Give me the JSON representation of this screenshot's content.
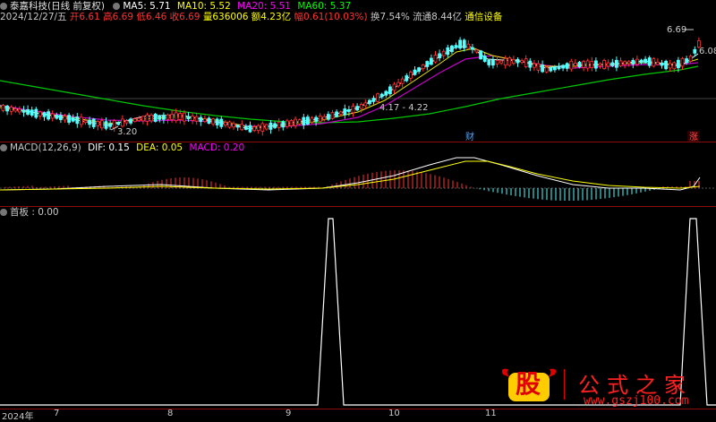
{
  "main_header": {
    "stock_name": "泰嘉科技(日线 前复权)",
    "ma5": "MA5: 5.71",
    "ma10": "MA10: 5.52",
    "ma20": "MA20: 5.51",
    "ma60": "MA60: 5.37"
  },
  "quote_line": {
    "date": "2024/12/27/五",
    "open": "开6.61",
    "high": "高6.69",
    "low": "低6.46",
    "close": "收6.69",
    "volume": "量636006",
    "amount": "额4.23亿",
    "change_pct": "幅0.61(10.03%)",
    "turnover": "换7.54%",
    "float_cap": "流通8.44亿",
    "sector": "通信设备"
  },
  "price_labels": {
    "high_mark": "6.69",
    "right_price": "6.08",
    "range_label": "4.17 - 4.22",
    "low_mark": "3.20"
  },
  "event_badges": {
    "cai": "财",
    "zhang": "涨"
  },
  "macd_header": {
    "name": "MACD(12,26,9)",
    "dif": "DIF: 0.15",
    "dea": "DEA: 0.05",
    "macd": "MACD: 0.20"
  },
  "shouban_header": {
    "label": "首板 : 0.00"
  },
  "x_axis": {
    "labels": [
      "2024年",
      "7",
      "8",
      "9",
      "10",
      "11"
    ]
  },
  "watermark": {
    "glyph": "股",
    "title": "公式之家",
    "url": "www.gszj100.com"
  },
  "colors": {
    "up": "#ff3232",
    "down": "#54ffff",
    "ma5": "#ffffff",
    "ma10": "#ffff00",
    "ma20": "#ff00ff",
    "ma60": "#00ff00",
    "separator": "#8a0b0b"
  }
}
